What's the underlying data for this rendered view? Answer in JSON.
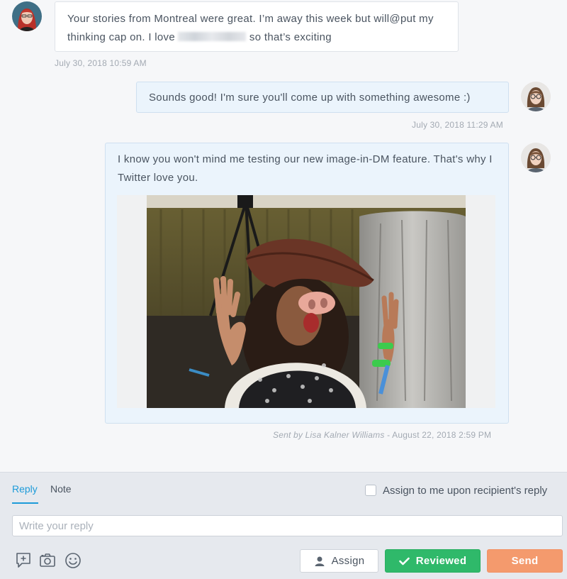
{
  "conversation": {
    "messages": [
      {
        "direction": "incoming",
        "text_part1": "Your stories from Montreal were great. I’m away this week but will@put my thinking cap on. I love ",
        "text_redacted": "",
        "text_part2": " so that’s exciting",
        "timestamp": "July 30, 2018 10:59 AM",
        "avatar_icon": "avatar-redhead-woman"
      },
      {
        "direction": "outgoing",
        "text": "Sounds good! I'm sure you'll come up with something awesome :)",
        "timestamp": "July 30, 2018 11:29 AM",
        "avatar_icon": "avatar-woman-glasses"
      },
      {
        "direction": "outgoing",
        "text": "I know you won't mind me testing our new image-in-DM feature. That's why I Twitter love you.",
        "image_icon": "photo-person-in-pirate-hat-and-pig-nose",
        "sent_by": "Sent by Lisa Kalner Williams",
        "timestamp": " - August 22, 2018 2:59 PM",
        "avatar_icon": "avatar-woman-glasses"
      }
    ]
  },
  "composer": {
    "tabs": [
      {
        "label": "Reply",
        "active": true
      },
      {
        "label": "Note",
        "active": false
      }
    ],
    "assign_checkbox_label": "Assign to me upon recipient's reply",
    "assign_checkbox_checked": false,
    "reply_placeholder": "Write your reply",
    "reply_value": "",
    "tool_icons": [
      "add-note-icon",
      "camera-icon",
      "emoji-icon"
    ],
    "buttons": {
      "assign": "Assign",
      "reviewed": "Reviewed",
      "send": "Send"
    }
  },
  "colors": {
    "accent": "#1d9bd9",
    "reviewed": "#2fb96a",
    "send": "#f49a6d",
    "outgoing_bubble": "#ebf4fc"
  }
}
